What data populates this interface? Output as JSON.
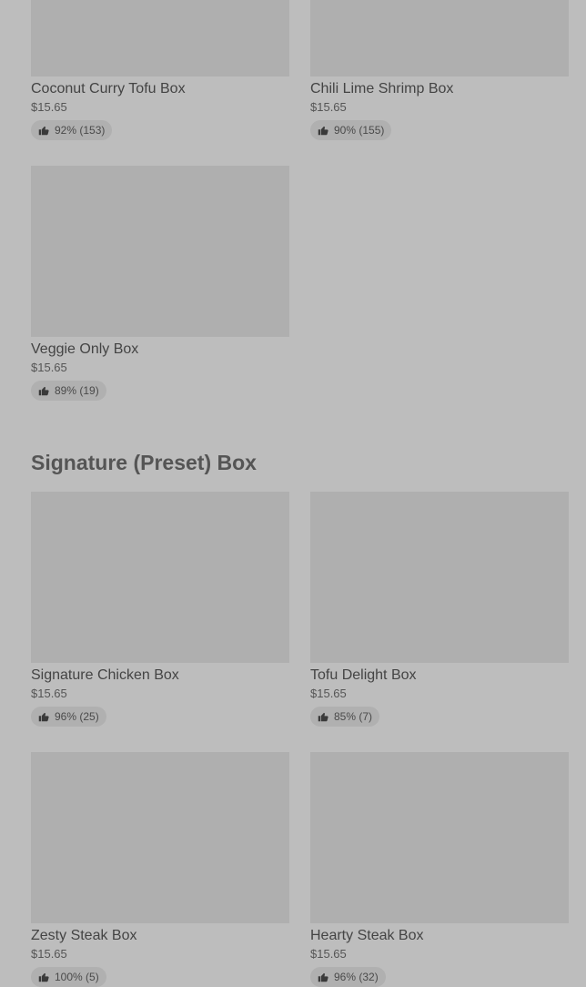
{
  "products_top": [
    {
      "name": "Coconut Curry Tofu Box",
      "price": "$15.65",
      "rating": "92% (153)"
    },
    {
      "name": "Chili Lime Shrimp Box",
      "price": "$15.65",
      "rating": "90% (155)"
    },
    {
      "name": "Veggie Only Box",
      "price": "$15.65",
      "rating": "89% (19)"
    }
  ],
  "section": {
    "title": "Signature (Preset) Box"
  },
  "products_signature": [
    {
      "name": "Signature Chicken Box",
      "price": "$15.65",
      "rating": "96% (25)"
    },
    {
      "name": "Tofu Delight Box",
      "price": "$15.65",
      "rating": "85% (7)"
    },
    {
      "name": "Zesty Steak Box",
      "price": "$15.65",
      "rating": "100% (5)"
    },
    {
      "name": "Hearty Steak Box",
      "price": "$15.65",
      "rating": "96% (32)"
    }
  ],
  "icons": {
    "rating": "thumbs-up-icon"
  }
}
